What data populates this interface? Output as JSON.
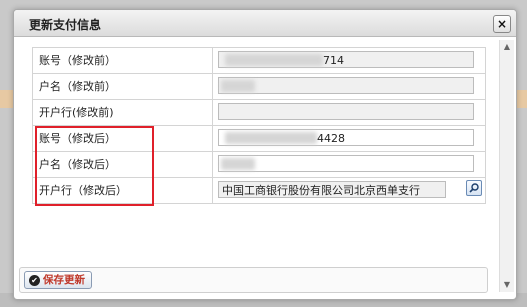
{
  "dialog": {
    "title": "更新支付信息",
    "close_glyph": "×"
  },
  "rows": [
    {
      "label": "账号（修改前）",
      "value_tail": "714",
      "readonly": true
    },
    {
      "label": "户名（修改前）",
      "value_tail": "",
      "readonly": true
    },
    {
      "label": "开户行(修改前)",
      "value_tail": "",
      "readonly": true
    },
    {
      "label": "账号（修改后）",
      "value_tail": "4428",
      "readonly": false
    },
    {
      "label": "户名（修改后）",
      "value_tail": "",
      "readonly": false
    },
    {
      "label": "开户行（修改后）",
      "value_tail": "中国工商银行股份有限公司北京西单支行",
      "readonly": true
    }
  ],
  "actions": {
    "save_label": "保存更新"
  },
  "icons": {
    "search": "search-icon",
    "save": "check-circle-icon",
    "close": "close-icon"
  },
  "colors": {
    "highlight": "#e0202a",
    "save_text": "#c0392b"
  }
}
